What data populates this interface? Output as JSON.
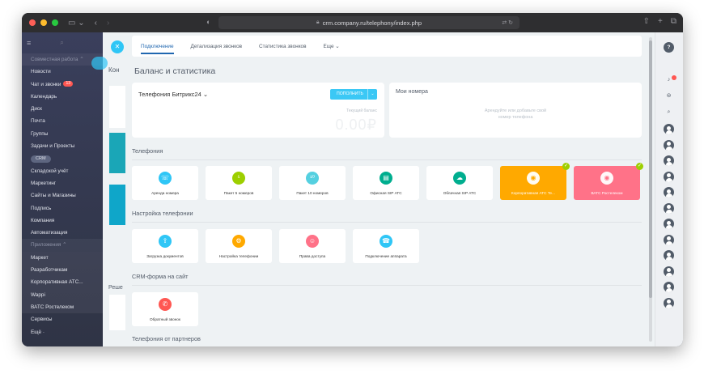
{
  "browser": {
    "url": "crm.company.ru/telephony/index.php"
  },
  "sidebar": {
    "items": [
      {
        "label": "Совместная работа ⌃",
        "kind": "group"
      },
      {
        "label": "Новости",
        "kind": "item"
      },
      {
        "label": "Чат и звонки",
        "kind": "item",
        "badge": "13"
      },
      {
        "label": "Календарь",
        "kind": "item"
      },
      {
        "label": "Диск",
        "kind": "item"
      },
      {
        "label": "Почта",
        "kind": "item"
      },
      {
        "label": "Группы",
        "kind": "item"
      },
      {
        "label": "Задачи и Проекты",
        "kind": "item"
      },
      {
        "label": "CRM",
        "kind": "pill"
      },
      {
        "label": "Складской учёт",
        "kind": "item"
      },
      {
        "label": "Маркетинг",
        "kind": "item"
      },
      {
        "label": "Сайты и Магазины",
        "kind": "item"
      },
      {
        "label": "Подпись",
        "kind": "item"
      },
      {
        "label": "Компания",
        "kind": "item"
      },
      {
        "label": "Автоматизация",
        "kind": "item"
      },
      {
        "label": "Приложения ⌃",
        "kind": "group"
      },
      {
        "label": "Маркет",
        "kind": "hl"
      },
      {
        "label": "Разработчикам",
        "kind": "hl"
      },
      {
        "label": "Корпоративная АТС...",
        "kind": "hl"
      },
      {
        "label": "Wappi",
        "kind": "hl"
      },
      {
        "label": "ВАТС Ростелеком",
        "kind": "hl"
      },
      {
        "label": "Сервисы",
        "kind": "item"
      },
      {
        "label": "Ещё ·",
        "kind": "item"
      }
    ]
  },
  "background": {
    "title_fragment": "Кон",
    "section_fragment": "Реше"
  },
  "tabs": [
    {
      "label": "Подключение",
      "active": true
    },
    {
      "label": "Детализация звонков",
      "active": false
    },
    {
      "label": "Статистика звонков",
      "active": false
    },
    {
      "label": "Еще ⌄",
      "active": false
    }
  ],
  "page_title": "Баланс и статистика",
  "balance": {
    "title": "Телефония Битрикс24 ⌄",
    "topup_label": "ПОПОЛНИТЬ",
    "current_label": "Текущий баланс",
    "amount": "0.00₽"
  },
  "numbers": {
    "title": "Мои номера",
    "empty_text": "Арендуйте или добавьте свой номер телефона"
  },
  "sections": {
    "telephony": "Телефония",
    "setup": "Настройка телефонии",
    "crm_form": "CRM-форма на сайт",
    "partners": "Телефония от партнеров"
  },
  "tiles_telephony": [
    {
      "label": "Аренда номера",
      "icon": "phone-rent-icon",
      "color": "#2fc6f6",
      "glyph": "☏"
    },
    {
      "label": "Пакет 5 номеров",
      "icon": "package-5-icon",
      "color": "#9dcf00",
      "glyph": "⁵"
    },
    {
      "label": "Пакет 10 номеров",
      "icon": "package-10-icon",
      "color": "#55d0e0",
      "glyph": "¹⁰"
    },
    {
      "label": "Офисная SIP АТС",
      "icon": "office-sip-icon",
      "color": "#00ae8f",
      "glyph": "▤"
    },
    {
      "label": "Облачная SIP АТС",
      "icon": "cloud-sip-icon",
      "color": "#00ae8f",
      "glyph": "☁"
    },
    {
      "label": "Корпоративная АТС Те...",
      "icon": "corporate-pbx-icon",
      "color": "#ffa900",
      "glyph": "◉",
      "style": "orange",
      "checked": true
    },
    {
      "label": "ВАТС Ростелеком",
      "icon": "rostelecom-icon",
      "color": "#ff7288",
      "glyph": "◉",
      "style": "pink",
      "checked": true
    }
  ],
  "tiles_setup": [
    {
      "label": "Загрузка документов",
      "icon": "documents-upload-icon",
      "color": "#2fc6f6",
      "glyph": "⇪"
    },
    {
      "label": "Настройка телефонии",
      "icon": "telephony-settings-icon",
      "color": "#ffa900",
      "glyph": "⚙"
    },
    {
      "label": "Права доступа",
      "icon": "access-rights-icon",
      "color": "#ff7288",
      "glyph": "☺"
    },
    {
      "label": "Подключение аппарата",
      "icon": "device-connect-icon",
      "color": "#2fc6f6",
      "glyph": "☎"
    }
  ],
  "tiles_crm": [
    {
      "label": "Обратный звонок",
      "icon": "callback-icon",
      "color": "#ff5752",
      "glyph": "✆"
    }
  ]
}
